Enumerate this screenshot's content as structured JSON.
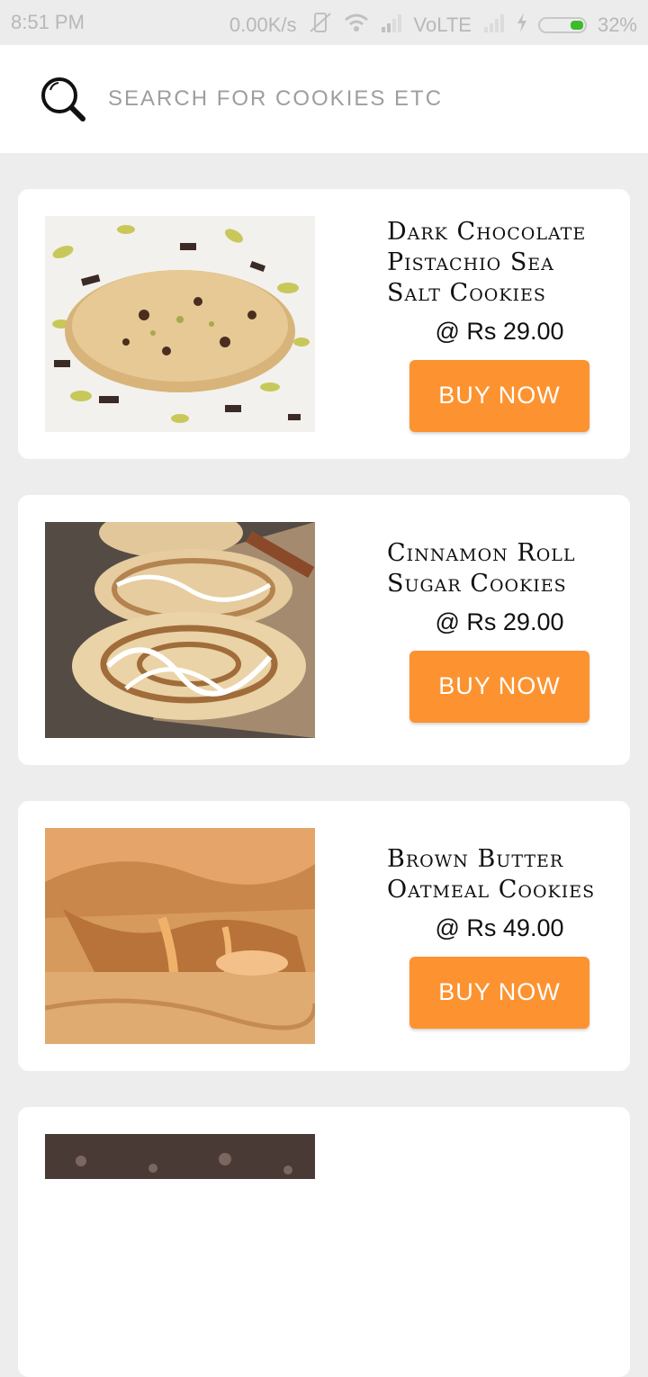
{
  "status_bar": {
    "time": "8:51 PM",
    "net_speed": "0.00K/s",
    "network": "VoLTE",
    "battery": "32%",
    "battery_level": 0.32
  },
  "search": {
    "placeholder": "SEARCH FOR COOKIES ETC"
  },
  "products": [
    {
      "name": "Dark Chocolate Pistachio Sea Salt Cookies",
      "price": "@ Rs 29.00",
      "button": "BUY NOW",
      "image": "cookie-pistachio-image"
    },
    {
      "name": "Cinnamon Roll Sugar Cookies",
      "price": "@ Rs 29.00",
      "button": "BUY NOW",
      "image": "cookie-cinnamon-image"
    },
    {
      "name": "Brown Butter Oatmeal Cookies",
      "price": "@ Rs 49.00",
      "button": "BUY NOW",
      "image": "cookie-caramel-image"
    }
  ],
  "colors": {
    "accent": "#fc9330",
    "background": "#ededed",
    "card": "#ffffff"
  }
}
